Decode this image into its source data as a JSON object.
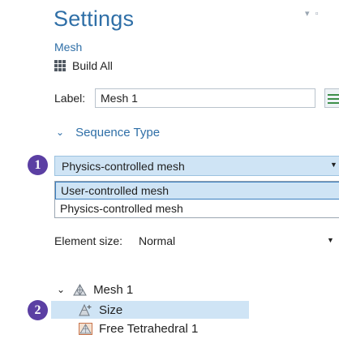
{
  "header": {
    "title": "Settings",
    "subtitle": "Mesh",
    "window_controls": "▾ ▫"
  },
  "toolbar": {
    "build_all_label": "Build All"
  },
  "label_field": {
    "label": "Label:",
    "value": "Mesh 1"
  },
  "section": {
    "chevron": "⌄",
    "title": "Sequence Type"
  },
  "sequence_type": {
    "selected": "Physics-controlled mesh",
    "options": [
      "User-controlled mesh",
      "Physics-controlled mesh"
    ],
    "highlighted_option": "User-controlled mesh"
  },
  "element_size": {
    "label": "Element size:",
    "value": "Normal"
  },
  "tree": {
    "root": {
      "label": "Mesh 1",
      "expanded": true
    },
    "children": [
      {
        "label": "Size",
        "selected": true,
        "icon": "size-icon"
      },
      {
        "label": "Free Tetrahedral 1",
        "selected": false,
        "icon": "free-tetrahedral-icon"
      }
    ]
  },
  "badges": [
    "1",
    "2"
  ],
  "colors": {
    "accent": "#2f6fa7",
    "selection": "#cfe4f5",
    "badge": "#5b3fa3"
  }
}
